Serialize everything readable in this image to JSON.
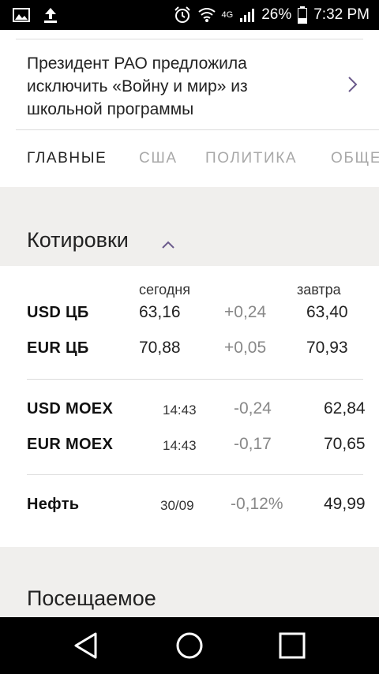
{
  "status_bar": {
    "battery": "26%",
    "time": "7:32 PM",
    "network": "4G"
  },
  "headline": {
    "text": "Президент РАО предложила исключить «Войну и мир» из школьной программы"
  },
  "tabs": [
    {
      "label": "ГЛАВНЫЕ"
    },
    {
      "label": "США"
    },
    {
      "label": "ПОЛИТИКА"
    },
    {
      "label": "ОБЩЕ"
    }
  ],
  "quotes_section": {
    "title": "Котировки",
    "header_today": "сегодня",
    "header_tomorrow": "завтра",
    "cb_rows": [
      {
        "label": "USD ЦБ",
        "today": "63,16",
        "change": "+0,24",
        "tomorrow": "63,40"
      },
      {
        "label": "EUR ЦБ",
        "today": "70,88",
        "change": "+0,05",
        "tomorrow": "70,93"
      }
    ],
    "moex_rows": [
      {
        "label": "USD MOEX",
        "time": "14:43",
        "change": "-0,24",
        "value": "62,84"
      },
      {
        "label": "EUR MOEX",
        "time": "14:43",
        "change": "-0,17",
        "value": "70,65"
      }
    ],
    "oil_row": {
      "label": "Нефть",
      "date": "30/09",
      "change": "-0,12%",
      "value": "49,99"
    }
  },
  "popular_section": {
    "title": "Посещаемое"
  },
  "colors": {
    "accent": "#6b5b8c",
    "section_bg": "#f0efed",
    "tab_inactive": "#a8a8a8"
  }
}
